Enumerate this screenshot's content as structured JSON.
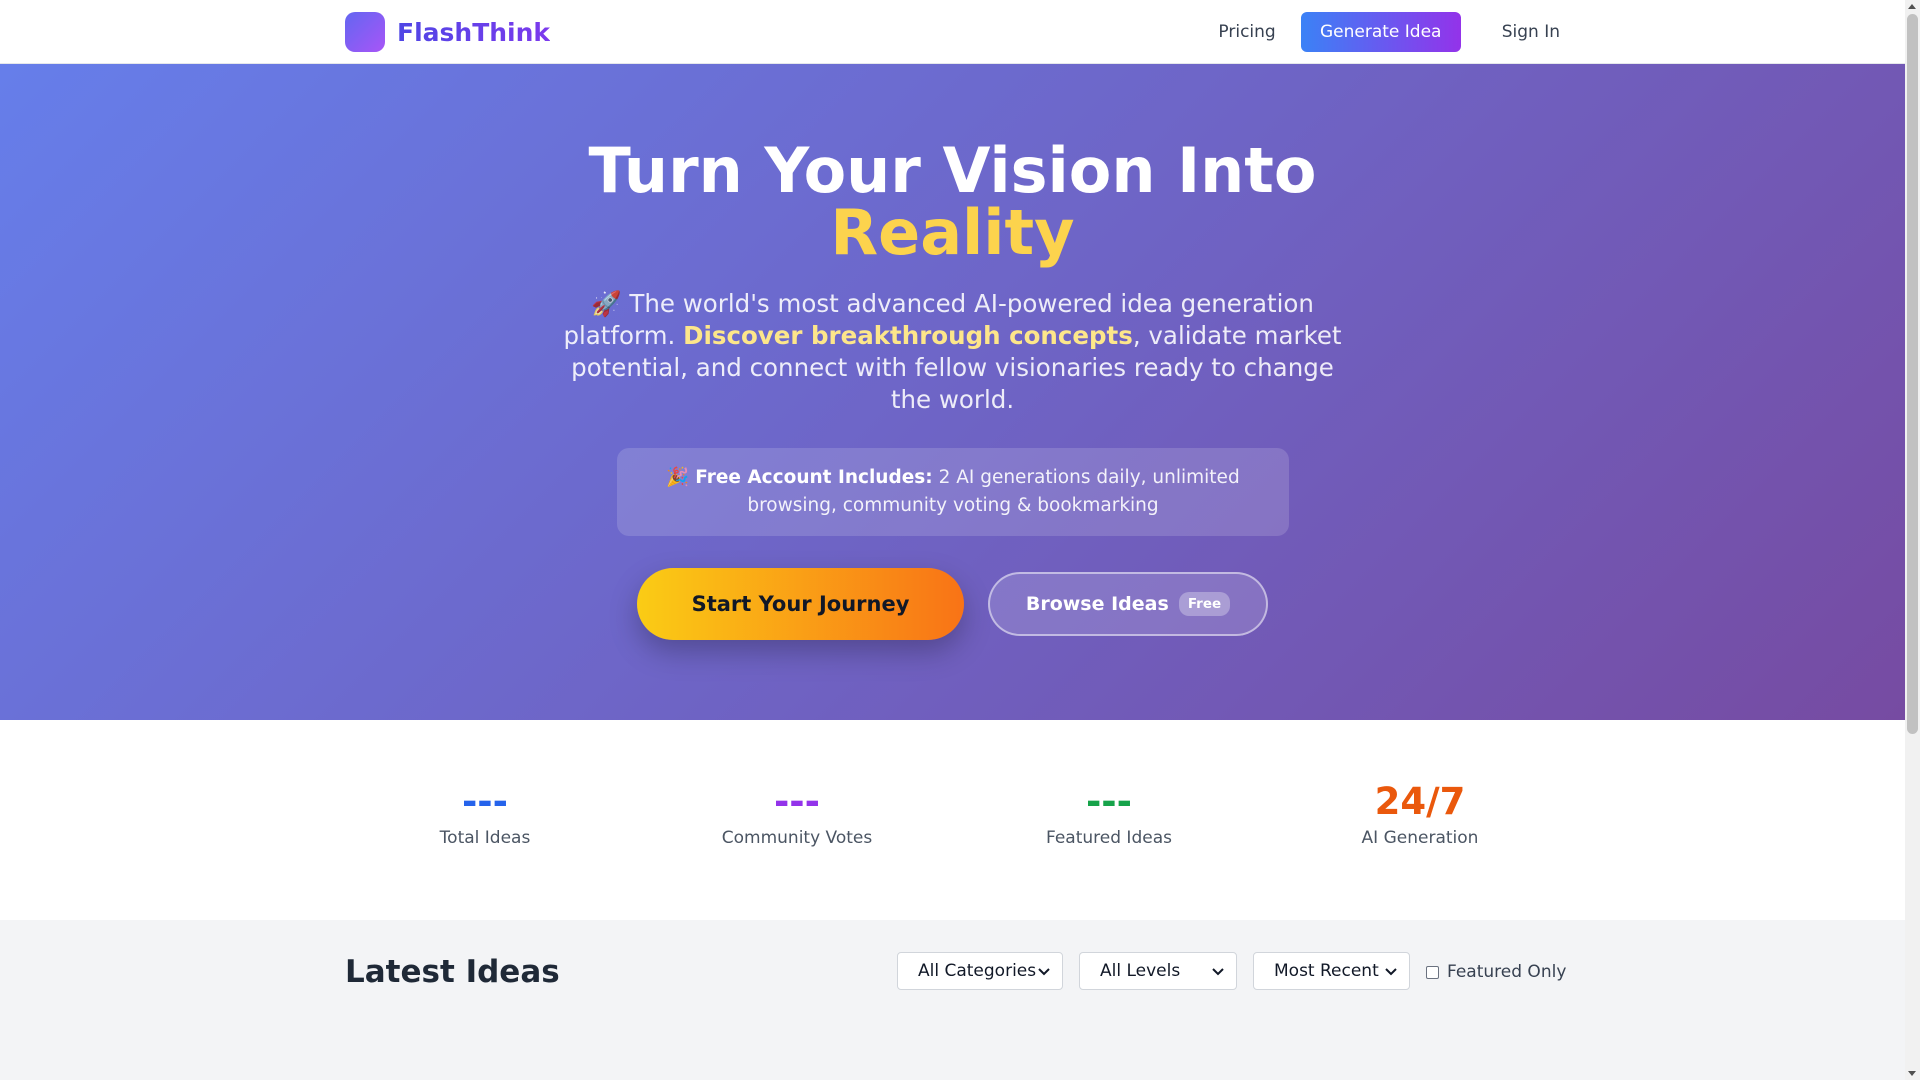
{
  "header": {
    "brand": "FlashThink",
    "nav": {
      "pricing": "Pricing",
      "generate": "Generate Idea",
      "signin": "Sign In"
    }
  },
  "hero": {
    "title_line1": "Turn Your Vision Into",
    "title_line2": "Reality",
    "sub_prefix": "🚀 The world's most advanced AI-powered idea generation platform. ",
    "sub_bold": "Discover breakthrough concepts",
    "sub_suffix": ", validate market potential, and connect with fellow visionaries ready to change the world.",
    "free_icon": "🎉",
    "free_label": "Free Account Includes:",
    "free_text": " 2 AI generations daily, unlimited browsing, community voting & bookmarking",
    "cta_primary": "Start Your Journey",
    "cta_secondary": "Browse Ideas",
    "cta_secondary_badge": "Free"
  },
  "stats": [
    {
      "value": "---",
      "label": "Total Ideas"
    },
    {
      "value": "---",
      "label": "Community Votes"
    },
    {
      "value": "---",
      "label": "Featured Ideas"
    },
    {
      "value": "24/7",
      "label": "AI Generation"
    }
  ],
  "latest": {
    "title": "Latest Ideas",
    "category_filter": "All Categories",
    "level_filter": "All Levels",
    "sort_filter": "Most Recent",
    "featured_only_label": "Featured Only",
    "featured_only_checked": false
  },
  "colors": {
    "hero_gradient_start": "#667eea",
    "hero_gradient_end": "#764ba2",
    "accent_yellow": "#fcd34d",
    "stat_blue": "#2563eb",
    "stat_purple": "#9333ea",
    "stat_green": "#16a34a",
    "stat_orange": "#ea580c"
  }
}
